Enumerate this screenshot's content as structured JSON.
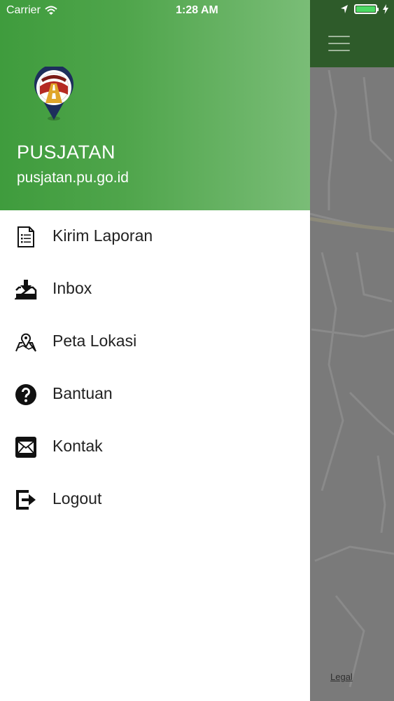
{
  "status_bar": {
    "carrier": "Carrier",
    "time": "1:28 AM",
    "battery_level": 1.0
  },
  "drawer": {
    "header": {
      "app_name": "PUSJATAN",
      "url": "pusjatan.pu.go.id",
      "gradient_colors": [
        "#3f9c3d",
        "#7abd77"
      ]
    },
    "items": [
      {
        "label": "Kirim Laporan",
        "icon": "report-icon"
      },
      {
        "label": "Inbox",
        "icon": "inbox-icon"
      },
      {
        "label": "Peta Lokasi",
        "icon": "map-location-icon"
      },
      {
        "label": "Bantuan",
        "icon": "help-icon"
      },
      {
        "label": "Kontak",
        "icon": "mail-icon"
      },
      {
        "label": "Logout",
        "icon": "logout-icon"
      }
    ]
  },
  "map": {
    "legal_label": "Legal",
    "header_color": "#2e5b2a"
  }
}
